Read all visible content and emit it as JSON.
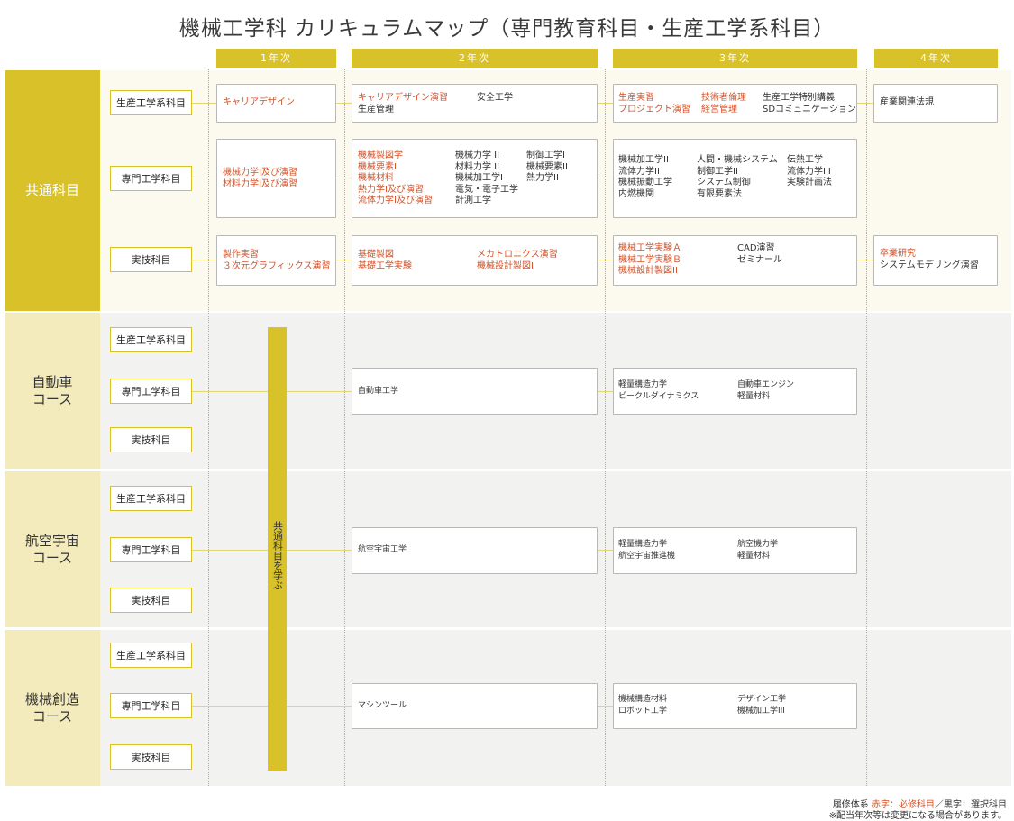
{
  "title": "機械工学科 カリキュラムマップ（専門教育科目・生産工学系科目）",
  "years": [
    "1年次",
    "2年次",
    "3年次",
    "4年次"
  ],
  "sections": {
    "common": "共通科目",
    "auto": "自動車\nコース",
    "aero": "航空宇宙\nコース",
    "mech": "機械創造\nコース"
  },
  "categories": {
    "production": "生産工学系科目",
    "specialty": "専門工学科目",
    "practical": "実技科目"
  },
  "common": {
    "production": {
      "y1": [
        "キャリアデザイン"
      ],
      "y2": {
        "col1": [
          "キャリアデザイン演習",
          "生産管理"
        ],
        "col1_req": [
          true,
          false
        ],
        "col2": [
          "安全工学"
        ]
      },
      "y3": {
        "col1": [
          "生産実習",
          "プロジェクト演習"
        ],
        "col2": [
          "技術者倫理",
          "経営管理"
        ],
        "col3": [
          "生産工学特別講義",
          "SDコミュニケーション"
        ]
      },
      "y4": [
        "産業関連法規"
      ]
    },
    "specialty": {
      "y1": [
        "機械力学Ⅰ及び演習",
        "材料力学Ⅰ及び演習"
      ],
      "y2": {
        "col1": [
          "機械製図学",
          "機械要素Ⅰ",
          "機械材料",
          "熱力学Ⅰ及び演習",
          "流体力学Ⅰ及び演習"
        ],
        "col2": [
          "機械力学 II",
          "材料力学 II",
          "機械加工学Ⅰ",
          "電気・電子工学",
          "計測工学"
        ],
        "col3": [
          "制御工学Ⅰ",
          "機械要素II",
          "熱力学II"
        ]
      },
      "y3": {
        "col1": [
          "機械加工学II",
          "流体力学II",
          "機械振動工学",
          "内燃機関"
        ],
        "col2": [
          "人間・機械システム",
          "制御工学II",
          "システム制御",
          "有限要素法"
        ],
        "col3": [
          "伝熱工学",
          "流体力学III",
          "実験計画法"
        ]
      }
    },
    "practical": {
      "y1": [
        "製作実習",
        "３次元グラフィックス演習"
      ],
      "y2": {
        "col1": [
          "基礎製図",
          "基礎工学実験"
        ],
        "col2": [
          "メカトロニクス演習",
          "機械設計製図Ⅰ"
        ]
      },
      "y3": {
        "col1": [
          "機械工学実験Ａ",
          "機械工学実験Ｂ",
          "機械設計製図II"
        ],
        "col2": [
          "CAD演習",
          "ゼミナール"
        ]
      },
      "y4": {
        "req": "卒業研究",
        "sel": "システムモデリング演習"
      }
    }
  },
  "auto": {
    "y2": [
      "自動車工学"
    ],
    "y3": {
      "col1": [
        "軽量構造力学",
        "ビークルダイナミクス"
      ],
      "col2": [
        "自動車エンジン",
        "軽量材料"
      ]
    }
  },
  "aero": {
    "y2": [
      "航空宇宙工学"
    ],
    "y3": {
      "col1": [
        "軽量構造力学",
        "航空宇宙推進機"
      ],
      "col2": [
        "航空機力学",
        "軽量材料"
      ]
    }
  },
  "mech": {
    "y2": [
      "マシンツール"
    ],
    "y3": {
      "col1": [
        "機械構造材料",
        "ロボット工学"
      ],
      "col2": [
        "デザイン工学",
        "機械加工学III"
      ]
    }
  },
  "vertical_label": "共通科目を学ぶ",
  "footer": {
    "line1_prefix": "履修体系",
    "line1_red": "赤字：必修科目",
    "line1_suffix": "／黒字：選択科目",
    "line2": "※配当年次等は変更になる場合があります。"
  },
  "colors": {
    "accent": "#d9c12a",
    "required": "#d4532a",
    "common_bg": "#fcf9ee",
    "course_bg": "#f2f3f1"
  }
}
